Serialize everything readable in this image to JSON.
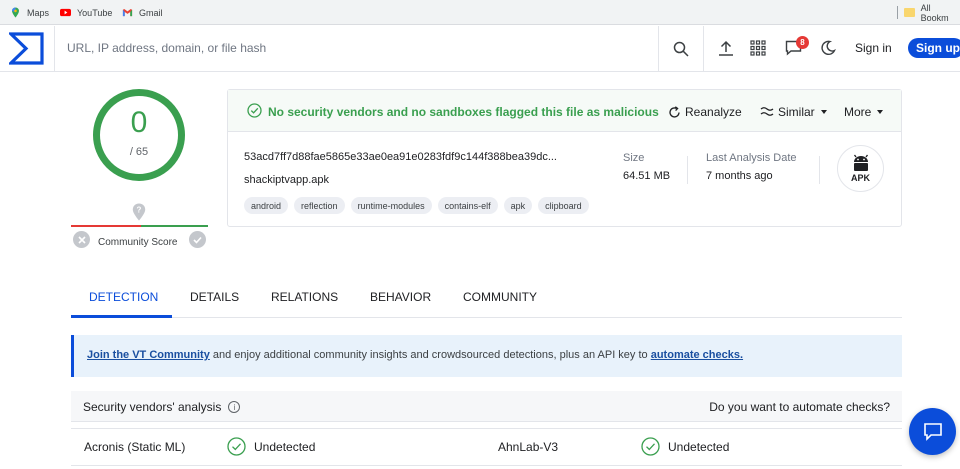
{
  "bookmarks": {
    "items": [
      {
        "label": "Maps",
        "icon": "maps-icon"
      },
      {
        "label": "YouTube",
        "icon": "youtube-icon"
      },
      {
        "label": "Gmail",
        "icon": "gmail-icon"
      }
    ],
    "all_bookmarks": "All Bookm"
  },
  "header": {
    "search_placeholder": "URL, IP address, domain, or file hash",
    "notification_count": "8",
    "sign_in": "Sign in",
    "sign_up": "Sign up"
  },
  "score": {
    "detections": "0",
    "total": "/ 65",
    "community_label": "Community Score"
  },
  "summary": {
    "status": "No security vendors and no sandboxes flagged this file as malicious",
    "actions": {
      "reanalyze": "Reanalyze",
      "similar": "Similar",
      "more": "More"
    },
    "hash": "53acd7ff7d88fae5865e33ae0ea91e0283fdf9c144f388bea39dc...",
    "filename": "shackiptvapp.apk",
    "tags": [
      "android",
      "reflection",
      "runtime-modules",
      "contains-elf",
      "apk",
      "clipboard"
    ],
    "size_label": "Size",
    "size_value": "64.51 MB",
    "last_analysis_label": "Last Analysis Date",
    "last_analysis_value": "7 months ago",
    "filetype": "APK"
  },
  "tabs": [
    "DETECTION",
    "DETAILS",
    "RELATIONS",
    "BEHAVIOR",
    "COMMUNITY"
  ],
  "banner": {
    "link1": "Join the VT Community",
    "text": " and enjoy additional community insights and crowdsourced detections, plus an API key to ",
    "link2": "automate checks."
  },
  "vendors": {
    "title": "Security vendors' analysis",
    "automate_prompt": "Do you want to automate checks?",
    "rows": [
      {
        "vendor": "Acronis (Static ML)",
        "result": "Undetected"
      },
      {
        "vendor": "AhnLab-V3",
        "result": "Undetected"
      }
    ]
  },
  "colors": {
    "brand": "#0b4dda",
    "clean": "#3a9f4f",
    "danger": "#e53935"
  }
}
